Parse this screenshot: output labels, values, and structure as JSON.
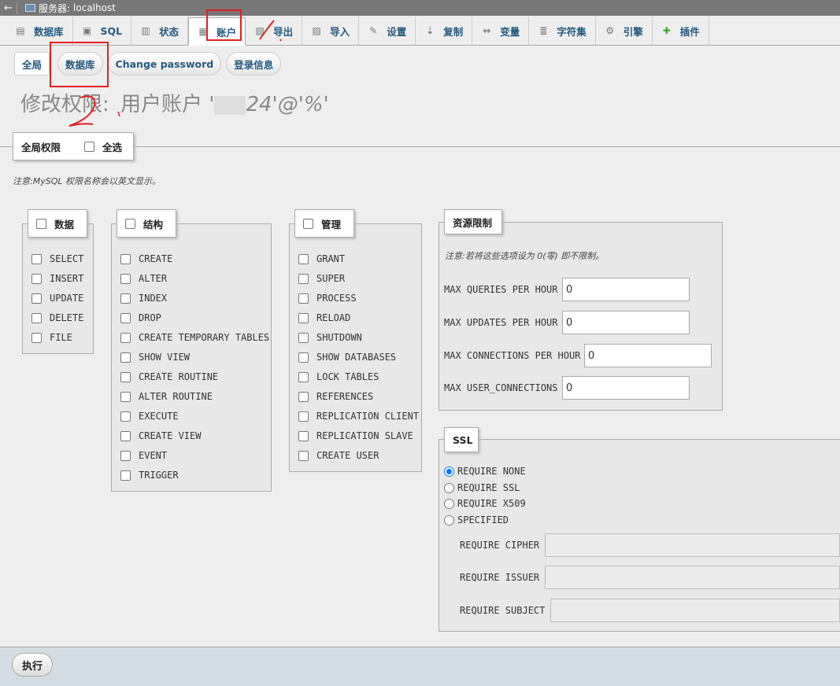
{
  "server_bar": {
    "back": "←",
    "label": "服务器:",
    "server": "localhost"
  },
  "tabs": [
    {
      "label": "数据库",
      "icon": "database-icon"
    },
    {
      "label": "SQL",
      "icon": "sql-icon"
    },
    {
      "label": "状态",
      "icon": "status-icon"
    },
    {
      "label": "账户",
      "icon": "accounts-icon",
      "active": true
    },
    {
      "label": "导出",
      "icon": "export-icon"
    },
    {
      "label": "导入",
      "icon": "import-icon"
    },
    {
      "label": "设置",
      "icon": "wrench-icon"
    },
    {
      "label": "复制",
      "icon": "replication-icon"
    },
    {
      "label": "变量",
      "icon": "variables-icon"
    },
    {
      "label": "字符集",
      "icon": "charset-icon"
    },
    {
      "label": "引擎",
      "icon": "engine-icon"
    },
    {
      "label": "插件",
      "icon": "plugin-icon"
    }
  ],
  "subtabs": [
    "全局",
    "数据库",
    "Change password",
    "登录信息"
  ],
  "title": {
    "prefix": "修改权限:",
    "account_label": "用户账户",
    "account_start": "'",
    "account_end": "24'@'%'"
  },
  "global_privs": {
    "legend": "全局权限",
    "select_all": "全选",
    "note": "注意:MySQL 权限名称会以英文显示。"
  },
  "data_group": {
    "legend": "数据",
    "items": [
      "SELECT",
      "INSERT",
      "UPDATE",
      "DELETE",
      "FILE"
    ]
  },
  "structure_group": {
    "legend": "结构",
    "items": [
      "CREATE",
      "ALTER",
      "INDEX",
      "DROP",
      "CREATE TEMPORARY TABLES",
      "SHOW VIEW",
      "CREATE ROUTINE",
      "ALTER ROUTINE",
      "EXECUTE",
      "CREATE VIEW",
      "EVENT",
      "TRIGGER"
    ]
  },
  "admin_group": {
    "legend": "管理",
    "items": [
      "GRANT",
      "SUPER",
      "PROCESS",
      "RELOAD",
      "SHUTDOWN",
      "SHOW DATABASES",
      "LOCK TABLES",
      "REFERENCES",
      "REPLICATION CLIENT",
      "REPLICATION SLAVE",
      "CREATE USER"
    ]
  },
  "resources": {
    "legend": "资源限制",
    "note": "注意:若将这些选项设为 0(零) 即不限制。",
    "fields": [
      {
        "label": "MAX QUERIES PER HOUR",
        "value": "0"
      },
      {
        "label": "MAX UPDATES PER HOUR",
        "value": "0"
      },
      {
        "label": "MAX CONNECTIONS PER HOUR",
        "value": "0"
      },
      {
        "label": "MAX USER_CONNECTIONS",
        "value": "0"
      }
    ]
  },
  "ssl": {
    "legend": "SSL",
    "options": [
      "REQUIRE NONE",
      "REQUIRE SSL",
      "REQUIRE X509",
      "SPECIFIED"
    ],
    "selected": "REQUIRE NONE",
    "fields": [
      "REQUIRE CIPHER",
      "REQUIRE ISSUER",
      "REQUIRE SUBJECT"
    ]
  },
  "footer": {
    "go": "执行"
  },
  "colors": {
    "link": "#235a81",
    "annotation": "#e02020",
    "radio": "#0075ff"
  }
}
